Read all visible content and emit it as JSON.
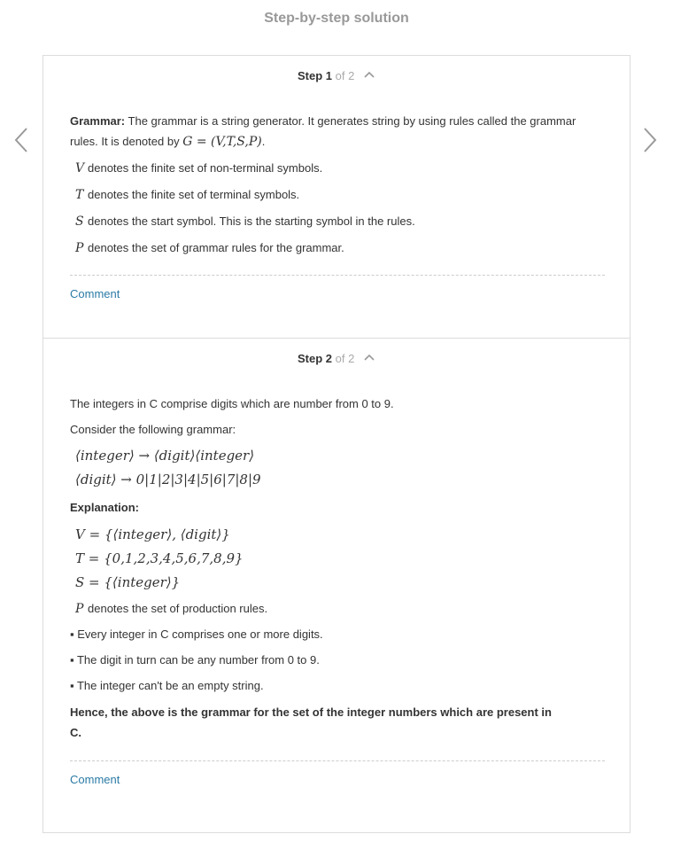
{
  "page_title": "Step-by-step solution",
  "steps": [
    {
      "label": "Step 1",
      "of": "of 2",
      "intro_bold": "Grammar:",
      "intro_text": " The grammar is a string generator. It generates string by using rules called the grammar rules. It is denoted by ",
      "intro_math": "G = (V,T,S,P)",
      "intro_end": ".",
      "definitions": [
        {
          "symbol": "V",
          "text": "denotes the finite set of non-terminal symbols."
        },
        {
          "symbol": "T",
          "text": "denotes the finite set of terminal symbols."
        },
        {
          "symbol": "S",
          "text": "denotes the start symbol. This is the starting symbol in the rules."
        },
        {
          "symbol": "P",
          "text": "denotes the set of grammar rules for the grammar."
        }
      ],
      "comment": "Comment"
    },
    {
      "label": "Step 2",
      "of": "of 2",
      "line1": "The integers in C comprise digits which are number from 0 to 9.",
      "line2": "Consider the following grammar:",
      "rules": [
        "⟨integer⟩ → ⟨digit⟩⟨integer⟩",
        "⟨digit⟩ → 0|1|2|3|4|5|6|7|8|9"
      ],
      "explanation_label": "Explanation:",
      "sets": [
        "V = {⟨integer⟩, ⟨digit⟩}",
        "T = {0,1,2,3,4,5,6,7,8,9}",
        "S = {⟨integer⟩}"
      ],
      "p_symbol": "P",
      "p_text": "denotes the set of production rules.",
      "bullets": [
        "▪ Every integer in C comprises one or more digits.",
        "▪ The digit in turn can be any number from 0 to 9.",
        "▪ The integer can't be an empty string."
      ],
      "conclusion": "Hence, the above is the grammar for the set of the integer numbers which are present in C.",
      "comment": "Comment"
    }
  ]
}
